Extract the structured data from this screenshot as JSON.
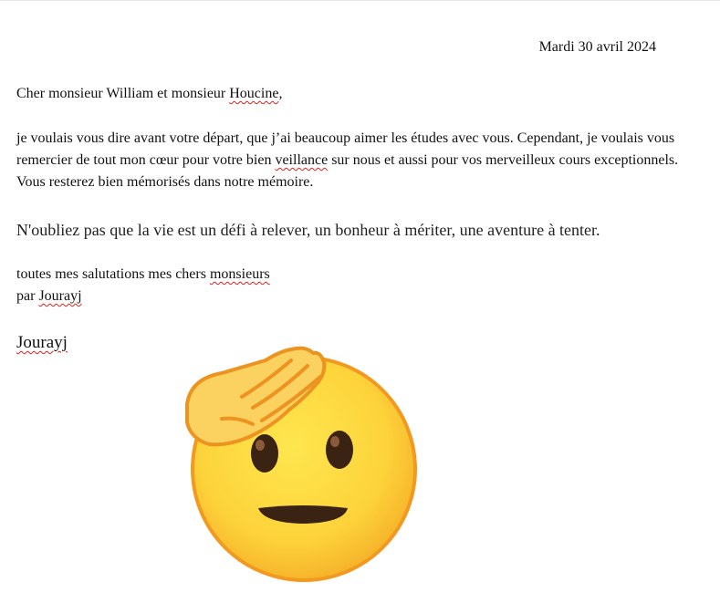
{
  "document": {
    "date": "Mardi 30 avril 2024",
    "greeting": {
      "prefix": "Cher monsieur William et monsieur ",
      "name": "Houcine",
      "suffix": ","
    },
    "body": {
      "part1": "je voulais vous dire avant votre départ, que j’ai beaucoup aimer les études avec vous. Cependant,  je voulais vous remercier de tout mon cœur pour votre bien ",
      "flagged_word": "veillance",
      "part2": " sur nous et aussi pour vos merveilleux cours exceptionnels. Vous resterez bien mémorisés dans notre mémoire."
    },
    "quote": " N'oubliez pas que la vie est un défi à relever, un bonheur à mériter, une aventure à tenter.",
    "closing": {
      "prefix": "toutes mes salutations mes chers ",
      "flagged_word": "monsieurs"
    },
    "byline": {
      "prefix": "par ",
      "name": "Jourayj"
    },
    "signature": "Jourayj",
    "emoji_icon": "saluting-face-emoji",
    "colors": {
      "spellcheck_underline": "#e0201b",
      "emoji_face": "#fdd33a",
      "emoji_outline": "#f29a1f",
      "emoji_hand": "#fbd160"
    }
  }
}
